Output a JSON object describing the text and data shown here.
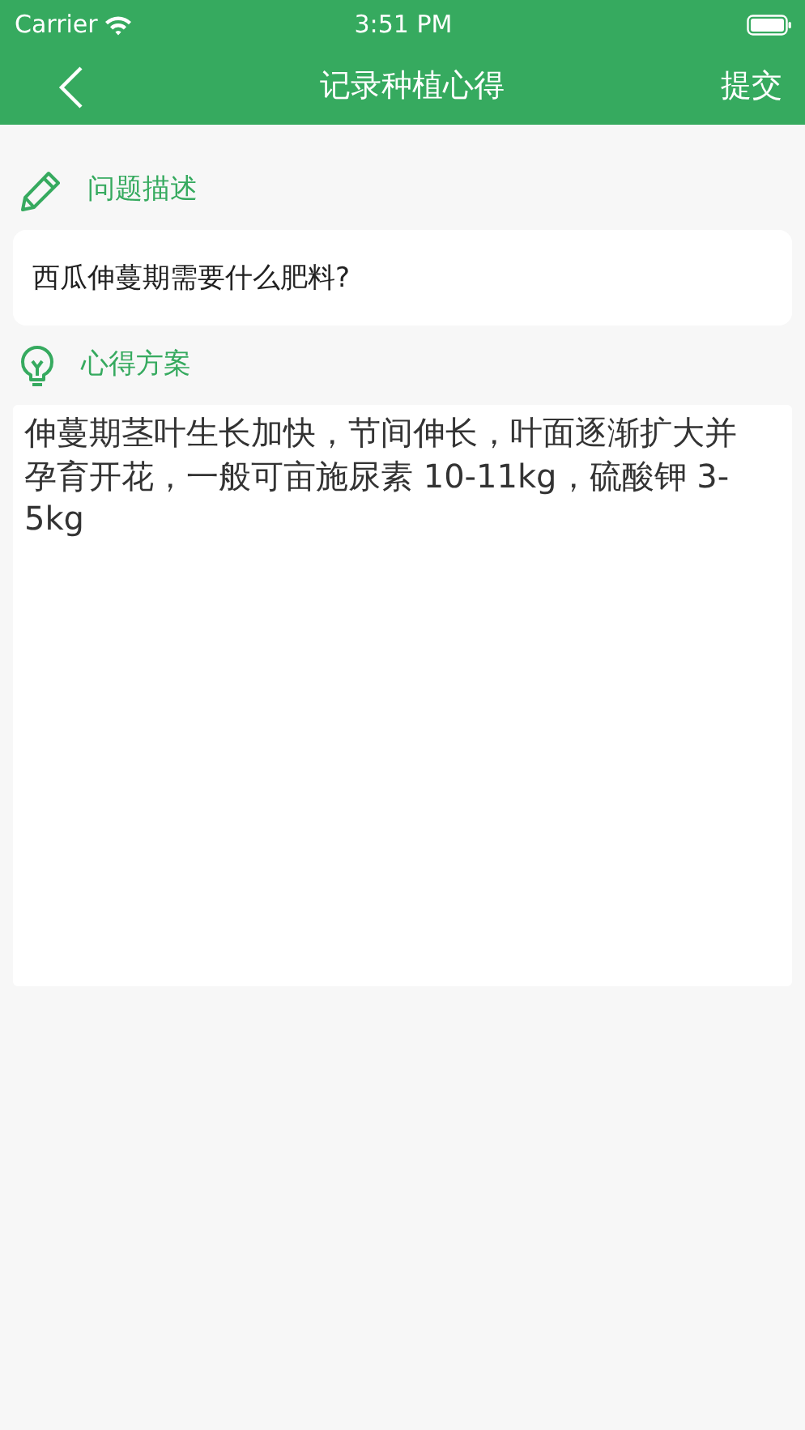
{
  "status_bar": {
    "carrier": "Carrier",
    "time": "3:51 PM"
  },
  "nav": {
    "title": "记录种植心得",
    "action": "提交"
  },
  "sections": [
    {
      "kind": "question",
      "label": "问题描述",
      "value": "西瓜伸蔓期需要什么肥料?"
    },
    {
      "kind": "answer",
      "label": "心得方案",
      "value": "伸蔓期茎叶生长加快，节间伸长，叶面逐渐扩大并孕育开花，一般可亩施尿素 10-11kg，硫酸钾 3-5kg"
    }
  ]
}
